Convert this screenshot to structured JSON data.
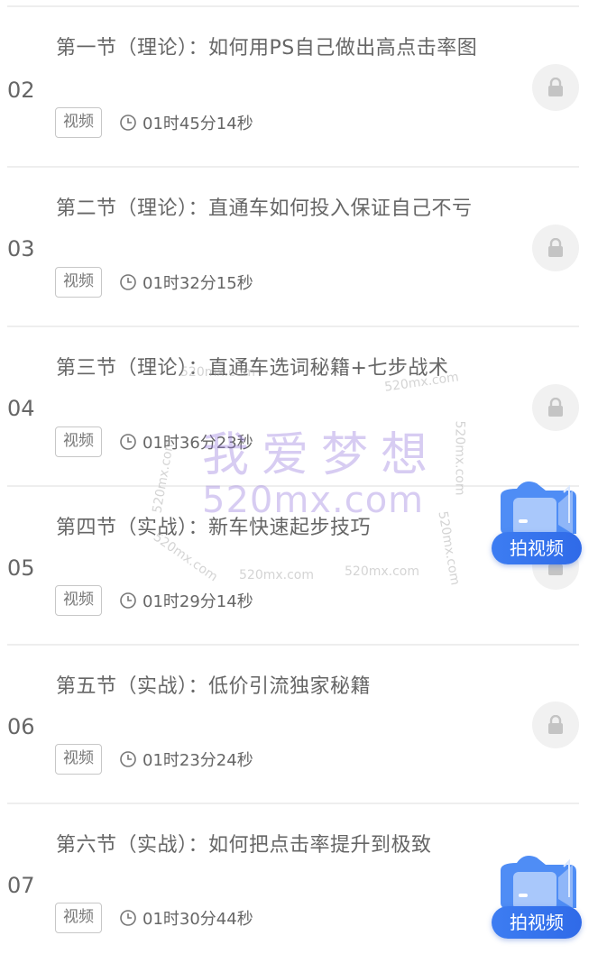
{
  "lessons": [
    {
      "num": "02",
      "title": "第一节（理论）：如何用PS自己做出高点击率图",
      "tag": "视频",
      "duration": "01时45分14秒"
    },
    {
      "num": "03",
      "title": "第二节（理论）：直通车如何投入保证自己不亏",
      "tag": "视频",
      "duration": "01时32分15秒"
    },
    {
      "num": "04",
      "title": "第三节（理论）：直通车选词秘籍+七步战术",
      "tag": "视频",
      "duration": "01时36分23秒"
    },
    {
      "num": "05",
      "title": "第四节（实战）：新车快速起步技巧",
      "tag": "视频",
      "duration": "01时29分14秒"
    },
    {
      "num": "06",
      "title": "第五节（实战）：低价引流独家秘籍",
      "tag": "视频",
      "duration": "01时23分24秒"
    },
    {
      "num": "07",
      "title": "第六节（实战）：如何把点击率提升到极致",
      "tag": "视频",
      "duration": "01时30分44秒"
    }
  ],
  "watermark": {
    "brand": "我爱梦想",
    "url": "520mx.com",
    "small": "520mx.com"
  },
  "fab": {
    "label": "拍视频"
  },
  "icons": {
    "lock": "lock-icon",
    "clock": "clock-icon",
    "camera": "camera-icon"
  },
  "colors": {
    "accent": "#3d7df2",
    "watermark": "#9678dc"
  }
}
